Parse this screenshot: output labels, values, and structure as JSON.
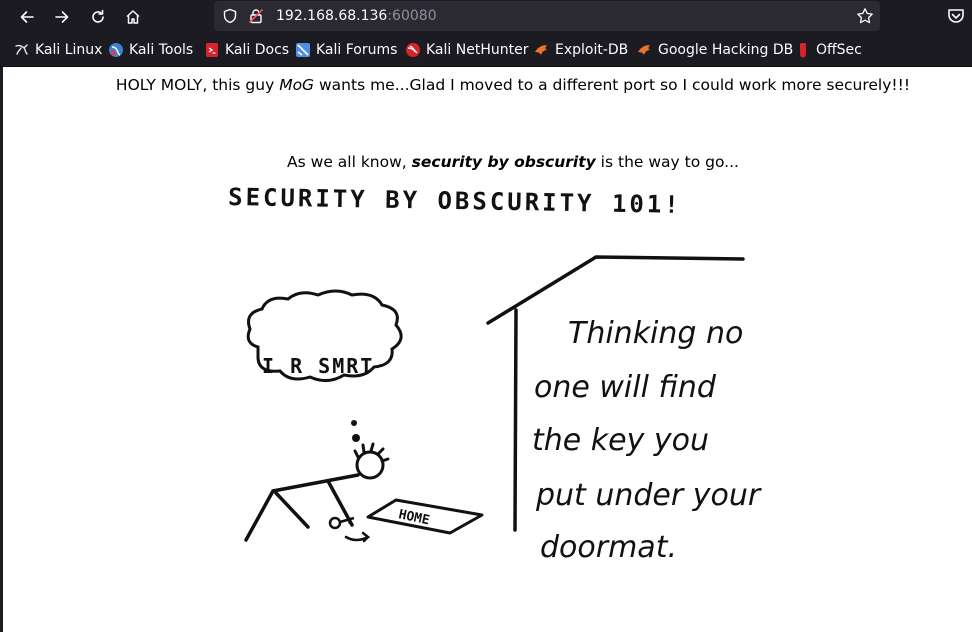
{
  "browser": {
    "url_host": "192.168.68.136",
    "url_port": ":60080",
    "bookmarks": [
      {
        "label": "Kali Linux",
        "icon": "kali-dragon-icon"
      },
      {
        "label": "Kali Tools",
        "icon": "kali-tools-icon"
      },
      {
        "label": "Kali Docs",
        "icon": "kali-docs-icon"
      },
      {
        "label": "Kali Forums",
        "icon": "kali-forums-icon"
      },
      {
        "label": "Kali NetHunter",
        "icon": "nethunter-icon"
      },
      {
        "label": "Exploit-DB",
        "icon": "exploit-db-icon"
      },
      {
        "label": "Google Hacking DB",
        "icon": "ghdb-icon"
      },
      {
        "label": "OffSec",
        "icon": "offsec-icon"
      }
    ]
  },
  "page": {
    "line1_pre": "HOLY MOLY, this guy ",
    "line1_em": "MoG",
    "line1_post": " wants me...Glad I moved to a different port so I could work more securely!!!",
    "line2_pre": "As we all know, ",
    "line2_strong": "security by obscurity",
    "line2_post": " is the way to go..."
  },
  "comic": {
    "title": "SECURITY BY OBSCURITY 101!",
    "thought": "I R SMRT",
    "doormat": "HOME",
    "caption": [
      "Thinking no",
      "one will find",
      "the key you",
      "put under your",
      "doormat."
    ]
  }
}
